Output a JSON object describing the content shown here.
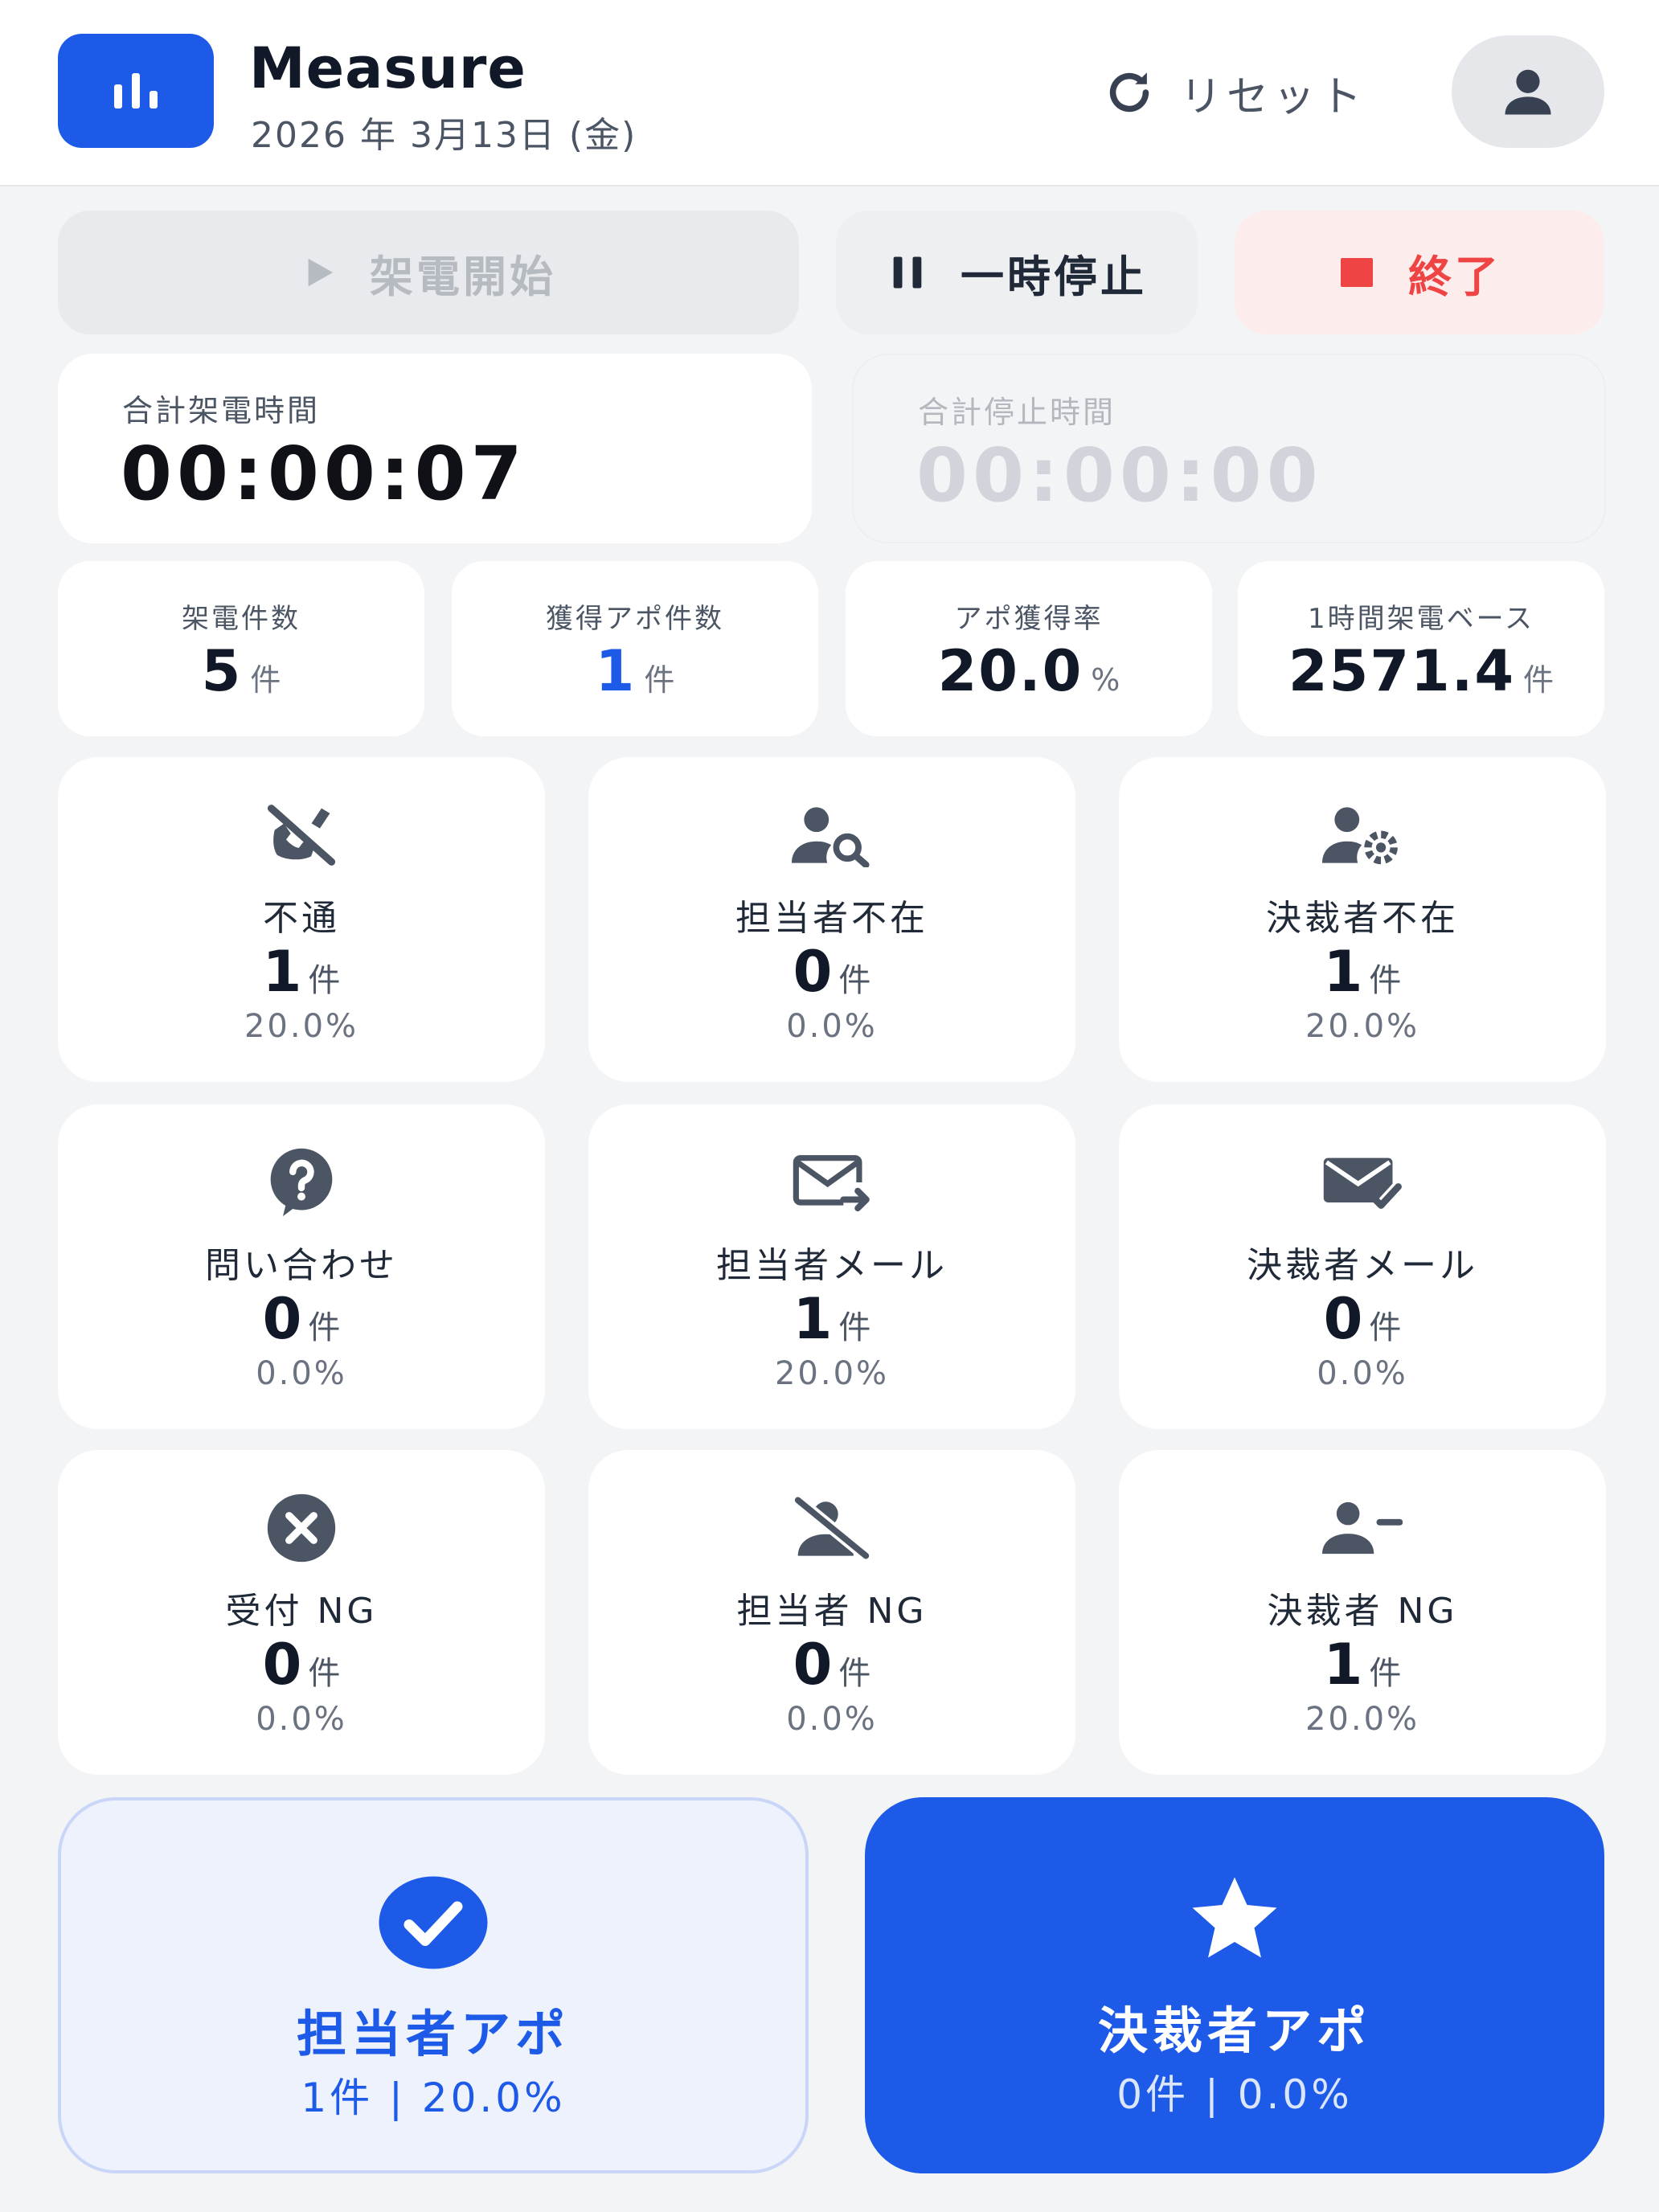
{
  "header": {
    "title": "Measure",
    "date": "2026 年 3月13日 (金)",
    "reset_label": "リセット"
  },
  "controls": {
    "start_label": "架電開始",
    "pause_label": "一時停止",
    "end_label": "終了"
  },
  "timers": {
    "total_label": "合計架電時間",
    "total_value": "00:00:07",
    "stop_label": "合計停止時間",
    "stop_value": "00:00:00"
  },
  "stats": [
    {
      "label": "架電件数",
      "value": "5",
      "unit": "件"
    },
    {
      "label": "獲得アポ件数",
      "value": "1",
      "unit": "件"
    },
    {
      "label": "アポ獲得率",
      "value": "20.0",
      "unit": "%"
    },
    {
      "label": "1時間架電ベース",
      "value": "2571.4",
      "unit": "件"
    }
  ],
  "outcomes": [
    {
      "label": "不通",
      "count": "1",
      "unit": "件",
      "pct": "20.0%",
      "icon": "phone-off-icon"
    },
    {
      "label": "担当者不在",
      "count": "0",
      "unit": "件",
      "pct": "0.0%",
      "icon": "user-search-icon"
    },
    {
      "label": "決裁者不在",
      "count": "1",
      "unit": "件",
      "pct": "20.0%",
      "icon": "user-gear-icon"
    },
    {
      "label": "問い合わせ",
      "count": "0",
      "unit": "件",
      "pct": "0.0%",
      "icon": "question-icon"
    },
    {
      "label": "担当者メール",
      "count": "1",
      "unit": "件",
      "pct": "20.0%",
      "icon": "mail-forward-icon"
    },
    {
      "label": "決裁者メール",
      "count": "0",
      "unit": "件",
      "pct": "0.0%",
      "icon": "mail-check-icon"
    },
    {
      "label": "受付 NG",
      "count": "0",
      "unit": "件",
      "pct": "0.0%",
      "icon": "x-circle-icon"
    },
    {
      "label": "担当者 NG",
      "count": "0",
      "unit": "件",
      "pct": "0.0%",
      "icon": "user-slash-icon"
    },
    {
      "label": "決裁者 NG",
      "count": "1",
      "unit": "件",
      "pct": "20.0%",
      "icon": "user-minus-icon"
    }
  ],
  "appointments": {
    "tanto_label": "担当者アポ",
    "tanto_sub": "1件 | 20.0%",
    "kessai_label": "決裁者アポ",
    "kessai_sub": "0件 | 0.0%"
  },
  "colors": {
    "accent": "#1d5ae8",
    "danger": "#ef4444",
    "background": "#f3f4f6",
    "card": "#ffffff"
  }
}
